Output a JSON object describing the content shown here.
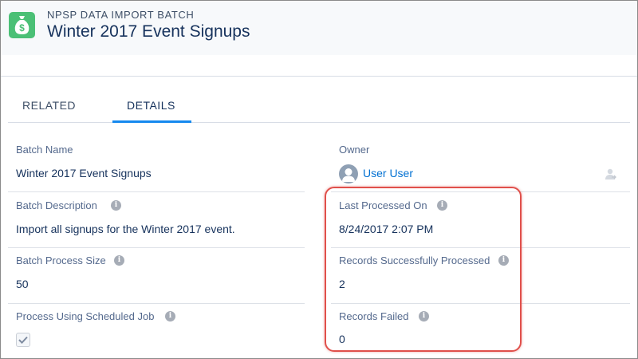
{
  "header": {
    "object_label": "NPSP DATA IMPORT BATCH",
    "record_title": "Winter 2017 Event Signups",
    "icon": "money-bag-icon",
    "icon_color": "#4bc076"
  },
  "tabs": [
    {
      "label": "RELATED",
      "active": false
    },
    {
      "label": "DETAILS",
      "active": true
    }
  ],
  "fields": {
    "batch_name": {
      "label": "Batch Name",
      "value": "Winter 2017 Event Signups"
    },
    "owner": {
      "label": "Owner",
      "value": "User User"
    },
    "batch_description": {
      "label": "Batch Description",
      "value": "Import all signups for the Winter 2017 event."
    },
    "last_processed_on": {
      "label": "Last Processed On",
      "value": "8/24/2017 2:07 PM"
    },
    "batch_process_size": {
      "label": "Batch Process Size",
      "value": "50"
    },
    "records_successfully_processed": {
      "label": "Records Successfully Processed",
      "value": "2"
    },
    "process_using_scheduled_job": {
      "label": "Process Using Scheduled Job",
      "checked": true
    },
    "records_failed": {
      "label": "Records Failed",
      "value": "0"
    }
  },
  "info_glyph": "i",
  "colors": {
    "link": "#0070d2",
    "active_tab": "#1589ee",
    "highlight": "#e0504b"
  }
}
